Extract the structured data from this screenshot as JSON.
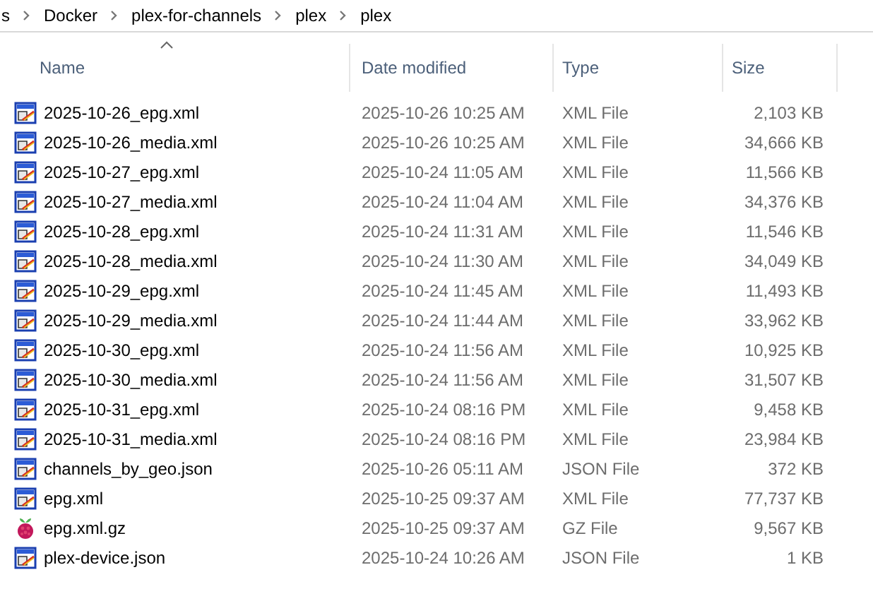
{
  "breadcrumb": [
    "s",
    "Docker",
    "plex-for-channels",
    "plex",
    "plex"
  ],
  "columns": [
    {
      "label": "Name",
      "sorted": true
    },
    {
      "label": "Date modified",
      "sorted": false
    },
    {
      "label": "Type",
      "sorted": false
    },
    {
      "label": "Size",
      "sorted": false
    }
  ],
  "files": [
    {
      "kind": "xml",
      "name": "2025-10-26_epg.xml",
      "date": "2025-10-26 10:25 AM",
      "type": "XML File",
      "size": "2,103 KB"
    },
    {
      "kind": "xml",
      "name": "2025-10-26_media.xml",
      "date": "2025-10-26 10:25 AM",
      "type": "XML File",
      "size": "34,666 KB"
    },
    {
      "kind": "xml",
      "name": "2025-10-27_epg.xml",
      "date": "2025-10-24 11:05 AM",
      "type": "XML File",
      "size": "11,566 KB"
    },
    {
      "kind": "xml",
      "name": "2025-10-27_media.xml",
      "date": "2025-10-24 11:04 AM",
      "type": "XML File",
      "size": "34,376 KB"
    },
    {
      "kind": "xml",
      "name": "2025-10-28_epg.xml",
      "date": "2025-10-24 11:31 AM",
      "type": "XML File",
      "size": "11,546 KB"
    },
    {
      "kind": "xml",
      "name": "2025-10-28_media.xml",
      "date": "2025-10-24 11:30 AM",
      "type": "XML File",
      "size": "34,049 KB"
    },
    {
      "kind": "xml",
      "name": "2025-10-29_epg.xml",
      "date": "2025-10-24 11:45 AM",
      "type": "XML File",
      "size": "11,493 KB"
    },
    {
      "kind": "xml",
      "name": "2025-10-29_media.xml",
      "date": "2025-10-24 11:44 AM",
      "type": "XML File",
      "size": "33,962 KB"
    },
    {
      "kind": "xml",
      "name": "2025-10-30_epg.xml",
      "date": "2025-10-24 11:56 AM",
      "type": "XML File",
      "size": "10,925 KB"
    },
    {
      "kind": "xml",
      "name": "2025-10-30_media.xml",
      "date": "2025-10-24 11:56 AM",
      "type": "XML File",
      "size": "31,507 KB"
    },
    {
      "kind": "xml",
      "name": "2025-10-31_epg.xml",
      "date": "2025-10-24 08:16 PM",
      "type": "XML File",
      "size": "9,458 KB"
    },
    {
      "kind": "xml",
      "name": "2025-10-31_media.xml",
      "date": "2025-10-24 08:16 PM",
      "type": "XML File",
      "size": "23,984 KB"
    },
    {
      "kind": "xml",
      "name": "channels_by_geo.json",
      "date": "2025-10-26 05:11 AM",
      "type": "JSON File",
      "size": "372 KB"
    },
    {
      "kind": "xml",
      "name": "epg.xml",
      "date": "2025-10-25 09:37 AM",
      "type": "XML File",
      "size": "77,737 KB"
    },
    {
      "kind": "archive",
      "name": "epg.xml.gz",
      "date": "2025-10-25 09:37 AM",
      "type": "GZ File",
      "size": "9,567 KB"
    },
    {
      "kind": "xml",
      "name": "plex-device.json",
      "date": "2025-10-24 10:26 AM",
      "type": "JSON File",
      "size": "1 KB"
    }
  ]
}
